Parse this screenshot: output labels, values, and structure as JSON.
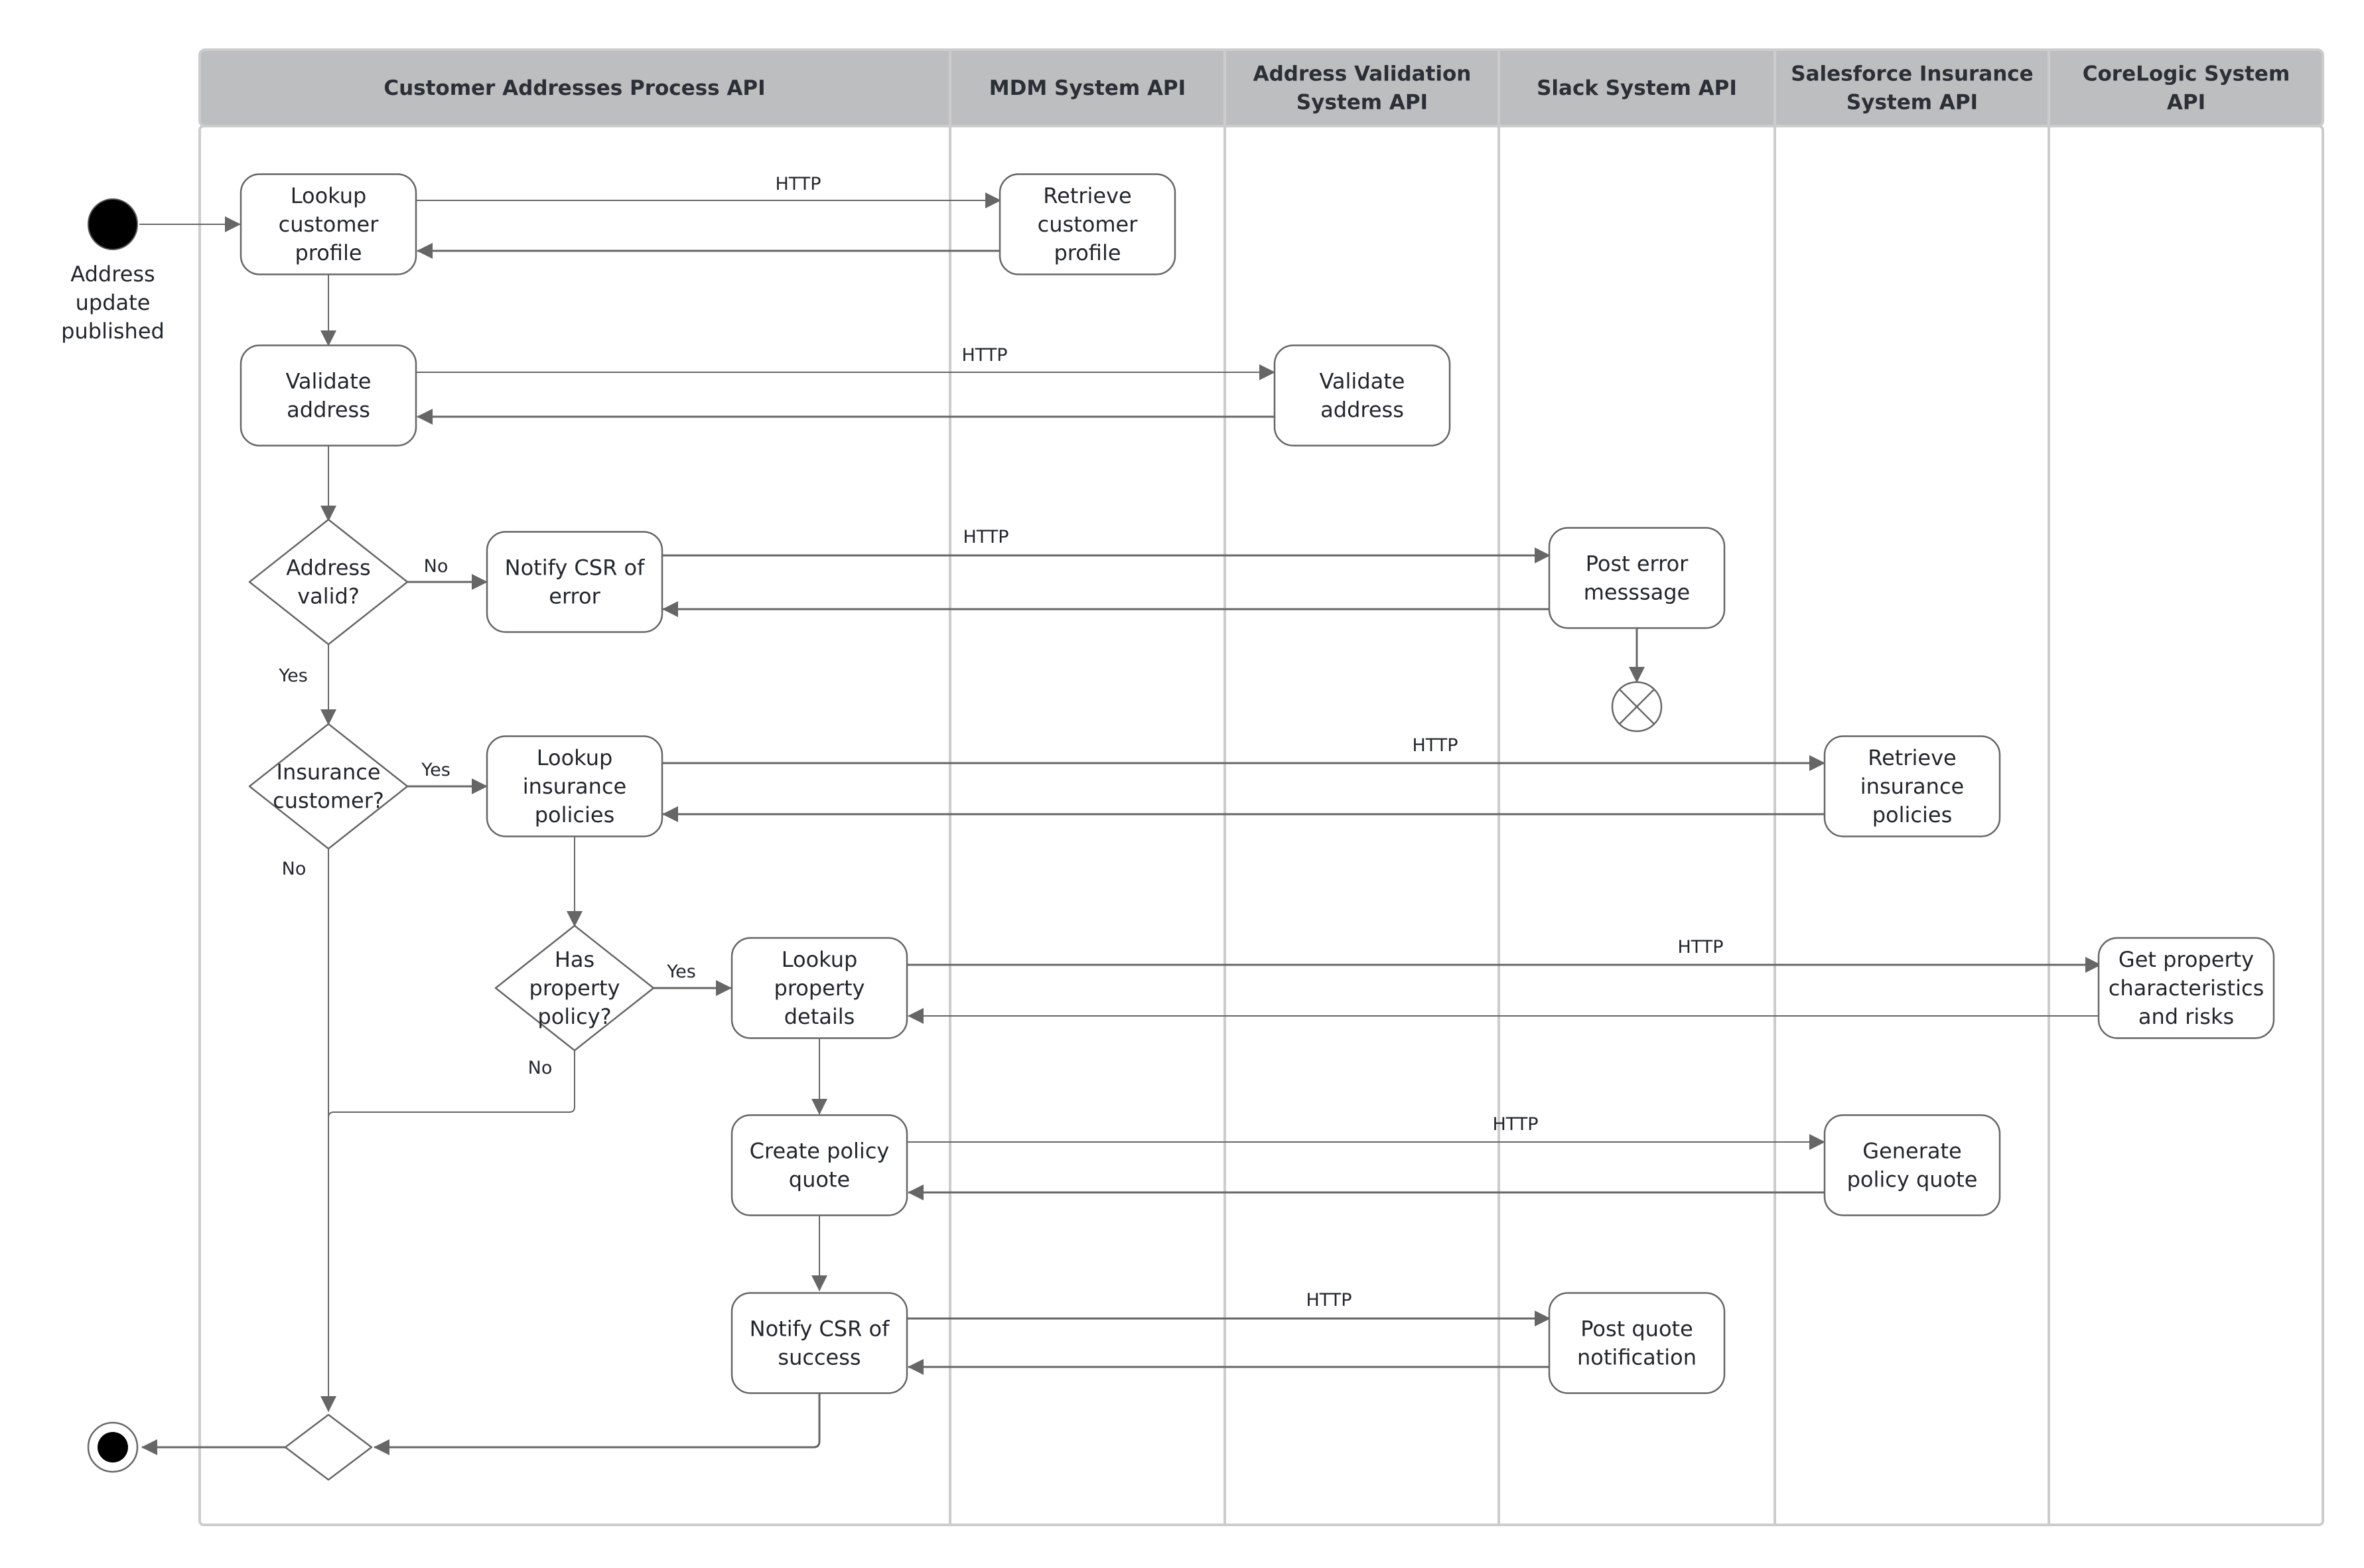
{
  "diagram": {
    "type": "activity-swimlane",
    "lanes": [
      {
        "id": "process",
        "title_lines": [
          "Customer Addresses Process API"
        ]
      },
      {
        "id": "mdm",
        "title_lines": [
          "MDM System API"
        ]
      },
      {
        "id": "addrval",
        "title_lines": [
          "Address Validation",
          "System API"
        ]
      },
      {
        "id": "slack",
        "title_lines": [
          "Slack System API"
        ]
      },
      {
        "id": "sfins",
        "title_lines": [
          "Salesforce Insurance",
          "System API"
        ]
      },
      {
        "id": "corelogic",
        "title_lines": [
          "CoreLogic System",
          "API"
        ]
      }
    ],
    "start": {
      "label_lines": [
        "Address",
        "update",
        "published"
      ]
    },
    "nodes": [
      {
        "id": "lookup_profile",
        "kind": "action",
        "lines": [
          "Lookup",
          "customer",
          "profile"
        ]
      },
      {
        "id": "retrieve_profile",
        "kind": "action",
        "lines": [
          "Retrieve",
          "customer",
          "profile"
        ]
      },
      {
        "id": "validate_address",
        "kind": "action",
        "lines": [
          "Validate",
          "address"
        ]
      },
      {
        "id": "validate_address_sys",
        "kind": "action",
        "lines": [
          "Validate",
          "address"
        ]
      },
      {
        "id": "address_valid",
        "kind": "decision",
        "lines": [
          "Address",
          "valid?"
        ]
      },
      {
        "id": "notify_error",
        "kind": "action",
        "lines": [
          "Notify CSR of",
          "error"
        ]
      },
      {
        "id": "post_error",
        "kind": "action",
        "lines": [
          "Post error",
          "messsage"
        ]
      },
      {
        "id": "insurance_customer",
        "kind": "decision",
        "lines": [
          "Insurance",
          "customer?"
        ]
      },
      {
        "id": "lookup_policies",
        "kind": "action",
        "lines": [
          "Lookup",
          "insurance",
          "policies"
        ]
      },
      {
        "id": "retrieve_policies",
        "kind": "action",
        "lines": [
          "Retrieve",
          "insurance",
          "policies"
        ]
      },
      {
        "id": "has_property",
        "kind": "decision",
        "lines": [
          "Has",
          "property",
          "policy?"
        ]
      },
      {
        "id": "lookup_property",
        "kind": "action",
        "lines": [
          "Lookup",
          "property",
          "details"
        ]
      },
      {
        "id": "get_property",
        "kind": "action",
        "lines": [
          "Get property",
          "characteristics",
          "and risks"
        ]
      },
      {
        "id": "create_quote",
        "kind": "action",
        "lines": [
          "Create policy",
          "quote"
        ]
      },
      {
        "id": "generate_quote",
        "kind": "action",
        "lines": [
          "Generate",
          "policy quote"
        ]
      },
      {
        "id": "notify_success",
        "kind": "action",
        "lines": [
          "Notify CSR of",
          "success"
        ]
      },
      {
        "id": "post_quote",
        "kind": "action",
        "lines": [
          "Post quote",
          "notification"
        ]
      },
      {
        "id": "merge",
        "kind": "merge",
        "lines": []
      }
    ],
    "edge_labels": {
      "http": "HTTP",
      "yes": "Yes",
      "no": "No"
    }
  }
}
